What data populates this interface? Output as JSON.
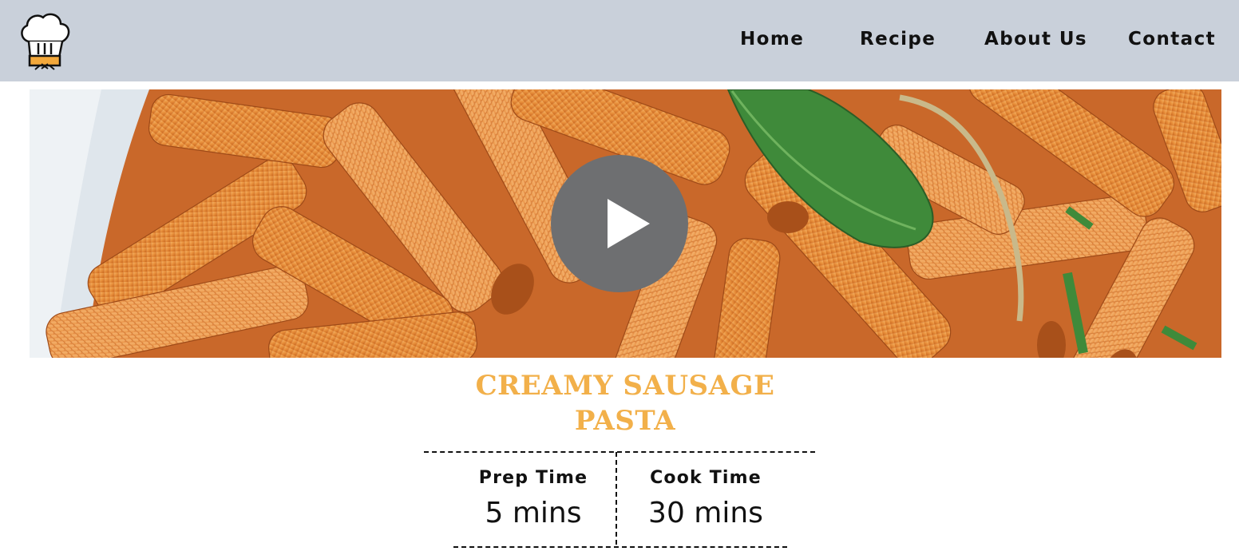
{
  "nav": {
    "logo_icon": "chef-hat-icon",
    "items": [
      {
        "label": "Home"
      },
      {
        "label": "Recipe"
      },
      {
        "label": "About Us"
      },
      {
        "label": "Contact"
      }
    ]
  },
  "hero": {
    "image_subject": "penne pasta with tomato sauce and basil",
    "play_icon": "play-icon"
  },
  "recipe": {
    "title_line1": "CREAMY SAUSAGE",
    "title_line2": "PASTA",
    "prep": {
      "label": "Prep Time",
      "value": "5 mins"
    },
    "cook": {
      "label": "Cook Time",
      "value": "30 mins"
    }
  },
  "colors": {
    "header_bg": "#c9d0da",
    "title": "#f2b04a",
    "play_button": "#6e6f71",
    "text": "#111111"
  }
}
